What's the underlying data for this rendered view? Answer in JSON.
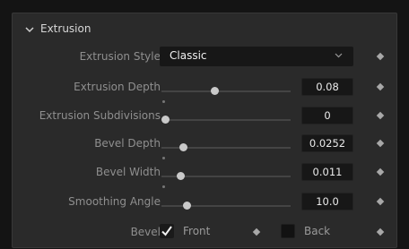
{
  "panel": {
    "title": "Extrusion",
    "rows": [
      {
        "label": "Extrusion Style",
        "value": "Classic"
      },
      {
        "label": "Extrusion Depth",
        "value": "0.08",
        "slider_fraction": 0.38
      },
      {
        "label": "Extrusion Subdivisions",
        "value": "0",
        "slider_fraction": 0.0
      },
      {
        "label": "Bevel Depth",
        "value": "0.0252",
        "slider_fraction": 0.14
      },
      {
        "label": "Bevel Width",
        "value": "0.011",
        "slider_fraction": 0.12
      },
      {
        "label": "Smoothing Angle",
        "value": "10.0",
        "slider_fraction": 0.17
      }
    ],
    "bevel": {
      "label": "Bevel",
      "front_label": "Front",
      "front_checked": true,
      "back_label": "Back",
      "back_checked": false
    }
  },
  "icons": {
    "collapse": "chevron-down-icon",
    "dropdown": "chevron-down-icon",
    "keyframe": "keyframe-diamond-icon",
    "check": "checkmark-icon"
  },
  "colors": {
    "panel_bg": "#2a2a2a",
    "field_bg": "#171717",
    "label": "#8f8f8f",
    "value": "#eaeaea"
  }
}
